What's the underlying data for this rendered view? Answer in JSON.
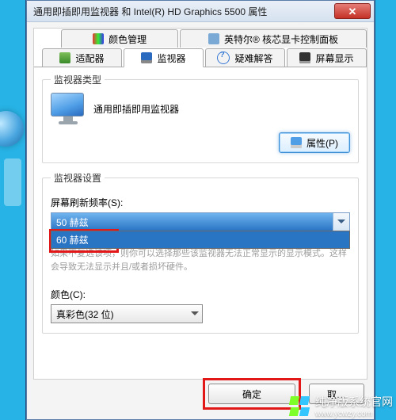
{
  "window": {
    "title": "通用即插即用监视器 和 Intel(R) HD Graphics 5500 属性",
    "close_glyph": "✕"
  },
  "tabs_row1": [
    {
      "label": "颜色管理"
    },
    {
      "label": "英特尔® 核芯显卡控制面板"
    }
  ],
  "tabs_row2": [
    {
      "label": "适配器"
    },
    {
      "label": "监视器"
    },
    {
      "label": "疑难解答"
    },
    {
      "label": "屏幕显示"
    }
  ],
  "group_type": {
    "legend": "监视器类型",
    "name": "通用即插即用监视器",
    "prop_button": "属性(P)"
  },
  "group_settings": {
    "legend": "监视器设置",
    "refresh_label": "屏幕刷新频率(S):",
    "refresh_selected": "50 赫兹",
    "refresh_option_hl": "60 赫兹",
    "hide_modes_note": "如果不复选该项，则你可以选择那些该监视器无法正常显示的显示模式。这样会导致无法显示并且/或者损坏硬件。",
    "color_label": "颜色(C):",
    "color_selected": "真彩色(32 位)"
  },
  "footer": {
    "ok": "确定",
    "cancel_partial": "取…"
  },
  "watermark": {
    "brand": "纯净版系统官网",
    "url": "www.ycwzy.com"
  }
}
